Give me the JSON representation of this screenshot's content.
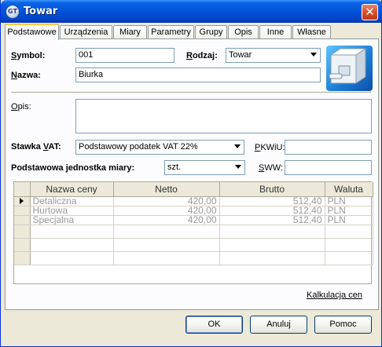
{
  "window": {
    "title": "Towar",
    "icon": "app-logo-icon",
    "close_icon": "close-icon",
    "close_glyph": "✕"
  },
  "tabs": [
    {
      "label": "Podstawowe",
      "active": true
    },
    {
      "label": "Urządzenia"
    },
    {
      "label": "Miary"
    },
    {
      "label": "Parametry"
    },
    {
      "label": "Grupy"
    },
    {
      "label": "Opis"
    },
    {
      "label": "Inne"
    },
    {
      "label": "Własne"
    }
  ],
  "form": {
    "symbol_label": "Symbol:",
    "symbol_value": "001",
    "rodzaj_label": "Rodzaj:",
    "rodzaj_value": "Towar",
    "nazwa_label": "Nazwa:",
    "nazwa_value": "Biurka",
    "opis_label": "Opis:",
    "opis_value": "",
    "stawka_label": "Stawka VAT:",
    "stawka_value": "Podstawowy podatek VAT 22%",
    "pkwiu_label": "PKWiU:",
    "pkwiu_value": "",
    "jednostka_label": "Podstawowa jednostka miary:",
    "jednostka_value": "szt.",
    "sww_label": "SWW:",
    "sww_value": ""
  },
  "price_table": {
    "columns": [
      "",
      "Nazwa ceny",
      "Netto",
      "Brutto",
      "Waluta"
    ],
    "rows": [
      {
        "name": "Detaliczna",
        "netto": "420,00",
        "brutto": "512,40",
        "waluta": "PLN",
        "current": true
      },
      {
        "name": "Hurtowa",
        "netto": "420,00",
        "brutto": "512,40",
        "waluta": "PLN"
      },
      {
        "name": "Specjalna",
        "netto": "420,00",
        "brutto": "512,40",
        "waluta": "PLN"
      }
    ]
  },
  "links": {
    "kalkulacja": "Kalkulacja cen"
  },
  "buttons": {
    "ok": "OK",
    "cancel": "Anuluj",
    "help": "Pomoc"
  },
  "icons": {
    "product_image": "product-box-icon",
    "row_indicator": "row-pointer-icon",
    "combo_arrow": "chevron-down-icon"
  },
  "colors": {
    "titlebar": "#0352d8",
    "tab_highlight": "#ffc83c",
    "window_bg": "#ece9d8",
    "disabled_text": "#9a9a9a"
  }
}
